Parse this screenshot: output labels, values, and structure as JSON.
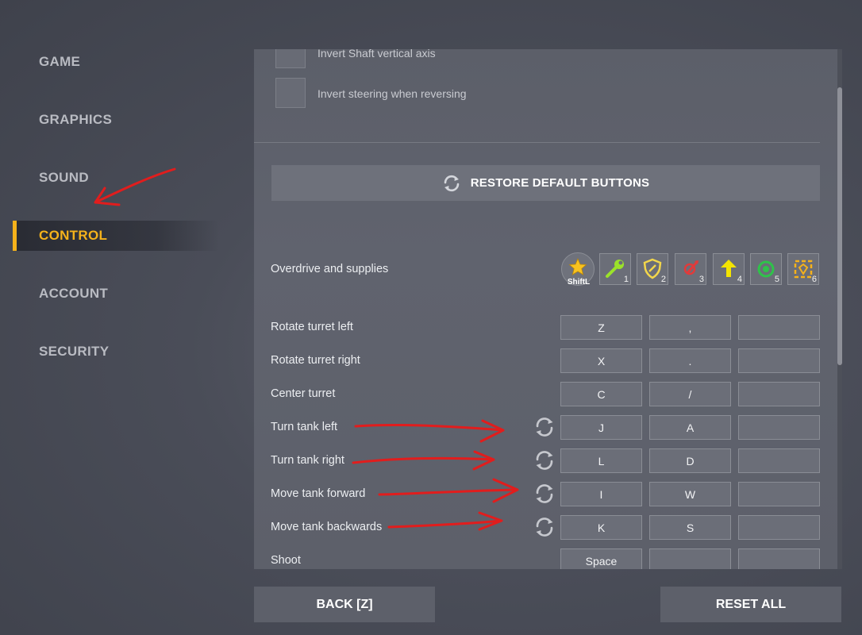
{
  "sidebar": {
    "items": [
      {
        "label": "GAME"
      },
      {
        "label": "GRAPHICS"
      },
      {
        "label": "SOUND"
      },
      {
        "label": "CONTROL"
      },
      {
        "label": "ACCOUNT"
      },
      {
        "label": "SECURITY"
      }
    ],
    "active": "CONTROL"
  },
  "options": {
    "invert_shaft": "Invert Shaft vertical axis",
    "invert_steering": "Invert steering when reversing"
  },
  "restore_button": "RESTORE DEFAULT BUTTONS",
  "supplies": {
    "label": "Overdrive and supplies",
    "overdrive_key": "ShiftL",
    "items": [
      {
        "icon": "wrench-icon",
        "key": "1",
        "color": "#9be22a"
      },
      {
        "icon": "shield-icon",
        "key": "2",
        "color": "#f2d64b"
      },
      {
        "icon": "damage-icon",
        "key": "3",
        "color": "#e13a3a"
      },
      {
        "icon": "speed-arrow-icon",
        "key": "4",
        "color": "#f4e400"
      },
      {
        "icon": "mine-icon",
        "key": "5",
        "color": "#2fc24a"
      },
      {
        "icon": "gold-box-icon",
        "key": "6",
        "color": "#f5b21b"
      }
    ]
  },
  "bindings": [
    {
      "label": "Rotate turret left",
      "keys": [
        "Z",
        ",",
        ""
      ],
      "reset": false
    },
    {
      "label": "Rotate turret right",
      "keys": [
        "X",
        ".",
        ""
      ],
      "reset": false
    },
    {
      "label": "Center turret",
      "keys": [
        "C",
        "/",
        ""
      ],
      "reset": false
    },
    {
      "label": "Turn tank left",
      "keys": [
        "J",
        "A",
        ""
      ],
      "reset": true
    },
    {
      "label": "Turn tank right",
      "keys": [
        "L",
        "D",
        ""
      ],
      "reset": true
    },
    {
      "label": "Move tank forward",
      "keys": [
        "I",
        "W",
        ""
      ],
      "reset": true
    },
    {
      "label": "Move tank backwards",
      "keys": [
        "K",
        "S",
        ""
      ],
      "reset": true
    },
    {
      "label": "Shoot",
      "keys": [
        "Space",
        "",
        ""
      ],
      "reset": false
    }
  ],
  "footer": {
    "back": "BACK [Z]",
    "reset_all": "RESET ALL"
  },
  "colors": {
    "accent": "#f5b21b",
    "annotation": "#e11d1d"
  }
}
